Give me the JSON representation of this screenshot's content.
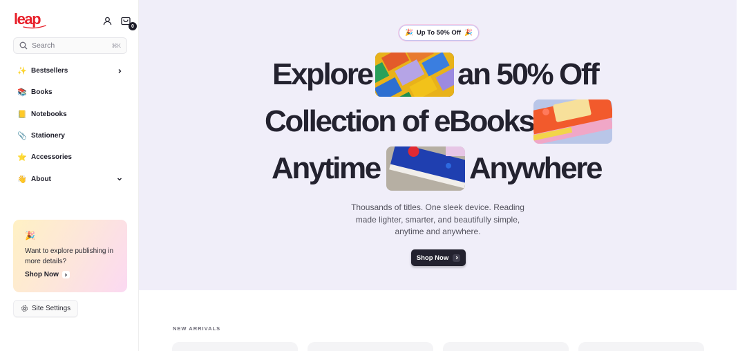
{
  "brand": {
    "logo_text": "leap",
    "accent": "#e8202a"
  },
  "header": {
    "account_icon": "user-icon",
    "cart_icon": "cart-icon",
    "cart_count": "0"
  },
  "search": {
    "placeholder": "Search",
    "shortcut": "⌘K",
    "icon": "search-icon"
  },
  "sidebar": {
    "items": [
      {
        "emoji": "✨",
        "label": "Bestsellers",
        "chevron": "right"
      },
      {
        "emoji": "📚",
        "label": "Books"
      },
      {
        "emoji": "📒",
        "label": "Notebooks"
      },
      {
        "emoji": "📎",
        "label": "Stationery"
      },
      {
        "emoji": "⭐",
        "label": "Accessories"
      },
      {
        "emoji": "👋",
        "label": "About",
        "chevron": "down"
      }
    ],
    "promo": {
      "emoji": "🎉",
      "text": "Want to explore publishing in more details?",
      "link_label": "Shop Now"
    },
    "settings_label": "Site Settings"
  },
  "hero": {
    "badge": "Up To 50% Off",
    "badge_emoji": "🎉",
    "line1_a": "Explore",
    "line1_b": "an 50% Off",
    "line2": "Collection of eBooks",
    "line3_a": "Anytime",
    "line3_b": "Anywhere",
    "subtitle_1": "Thousands of titles. One sleek device. Reading",
    "subtitle_2": "made lighter, smarter, and beautifully simple,",
    "subtitle_3": "anytime and anywhere.",
    "cta_label": "Shop Now",
    "background": "#f0eef9"
  },
  "arrivals": {
    "title": "NEW ARRIVALS"
  }
}
